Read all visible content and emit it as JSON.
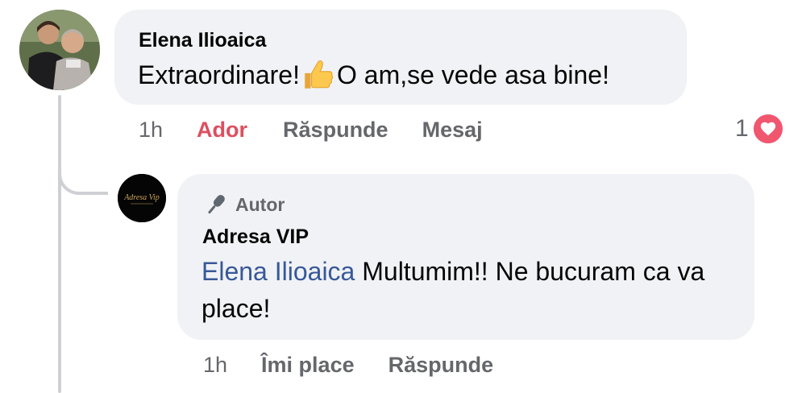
{
  "comment": {
    "author": "Elena Ilioaica",
    "text_before_emoji": "Extraordinare!",
    "emoji": "thumbs-up",
    "text_after_emoji": "O am,se vede asa bine!",
    "time": "1h",
    "actions": {
      "reaction_label": "Ador",
      "reply_label": "Răspunde",
      "message_label": "Mesaj"
    },
    "reaction_count": "1",
    "reaction_type": "heart",
    "reaction_color": "#f0566e"
  },
  "reply": {
    "badge": "Autor",
    "badge_icon": "microphone-icon",
    "author": "Adresa VIP",
    "avatar_logo_text": "Adresa Vip",
    "mention": "Elena Ilioaica",
    "text": " Multumim!! Ne bucuram ca va place!",
    "time": "1h",
    "actions": {
      "like_label": "Îmi place",
      "reply_label": "Răspunde"
    }
  },
  "colors": {
    "bubble_bg": "#f0f2f5",
    "secondary_text": "#65676b",
    "mention": "#385898",
    "active_reaction": "#dd4f5f"
  }
}
